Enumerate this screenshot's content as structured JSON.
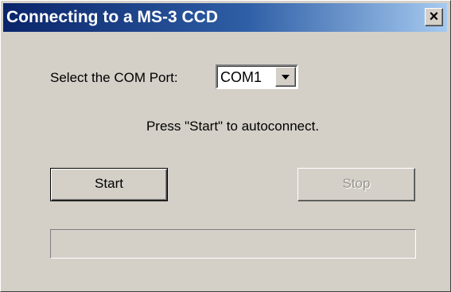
{
  "window": {
    "title": "Connecting to a MS-3 CCD",
    "close_glyph": "×",
    "close_icon": "close-icon"
  },
  "com_port": {
    "label": "Select the COM Port:",
    "selected": "COM1",
    "dropdown_icon": "chevron-down-icon"
  },
  "hint": "Press \"Start\" to autoconnect.",
  "buttons": {
    "start_label": "Start",
    "stop_label": "Stop",
    "stop_enabled": false
  },
  "progress": {
    "value": 0
  },
  "colors": {
    "titlebar_start": "#0a246a",
    "titlebar_end": "#a6caf0",
    "face": "#d4d0c8"
  }
}
